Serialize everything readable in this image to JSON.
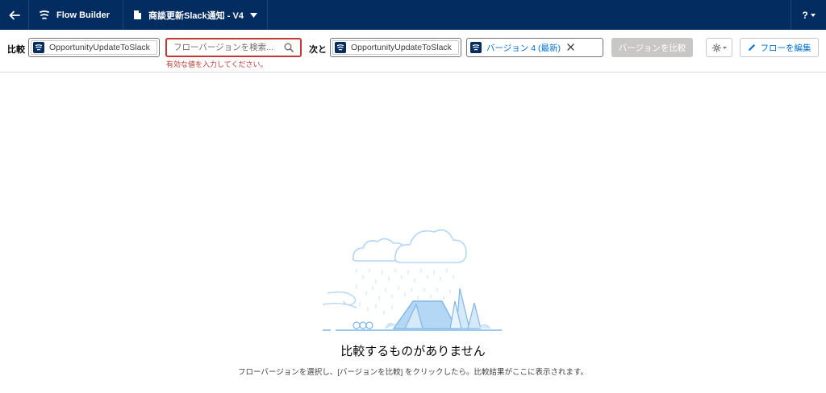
{
  "header": {
    "brand": "Flow Builder",
    "flow_title": "商談更新Slack通知 - V4",
    "help": "?"
  },
  "toolbar": {
    "compare_label": "比較",
    "flow_a": "OpportunityUpdateToSlack",
    "search_placeholder": "フローバージョンを検索...",
    "search_error": "有効な値を入力してください。",
    "with_label": "次と",
    "flow_b": "OpportunityUpdateToSlack",
    "version_b": "バージョン 4 (最新)",
    "compare_button": "バージョンを比較",
    "edit_button": "フローを編集"
  },
  "empty_state": {
    "title": "比較するものがありません",
    "description": "フローバージョンを選択し、[バージョンを比較] をクリックしたら。比較結果がここに表示されます。"
  },
  "colors": {
    "header_bg": "#032d60",
    "accent": "#0070d2",
    "error": "#c23934",
    "disabled": "#c9c7c5"
  }
}
